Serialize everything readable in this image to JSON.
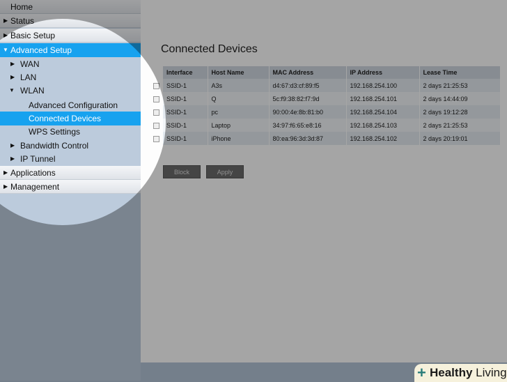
{
  "sidebar": {
    "items": [
      {
        "label": "Home"
      },
      {
        "label": "Status"
      },
      {
        "label": "Basic Setup"
      },
      {
        "label": "Advanced Setup"
      },
      {
        "label": "WAN"
      },
      {
        "label": "LAN"
      },
      {
        "label": "WLAN"
      },
      {
        "label": "Advanced Configuration"
      },
      {
        "label": "Connected Devices"
      },
      {
        "label": "WPS Settings"
      },
      {
        "label": "Bandwidth Control"
      },
      {
        "label": "IP Tunnel"
      },
      {
        "label": "Applications"
      },
      {
        "label": "Management"
      }
    ]
  },
  "main": {
    "title": "Connected Devices",
    "columns": [
      "Interface",
      "Host Name",
      "MAC Address",
      "IP Address",
      "Lease Time"
    ],
    "rows": [
      [
        "SSID-1",
        "A3s",
        "d4:67:d3:cf:89:f5",
        "192.168.254.100",
        "2 days 21:25:53"
      ],
      [
        "SSID-1",
        "Q",
        "5c:f9:38:82:f7:9d",
        "192.168.254.101",
        "2 days 14:44:09"
      ],
      [
        "SSID-1",
        "pc",
        "90:00:4e:8b:81:b0",
        "192.168.254.104",
        "2 days 19:12:28"
      ],
      [
        "SSID-1",
        "Laptop",
        "34:97:f6:65:e8:16",
        "192.168.254.103",
        "2 days 21:25:53"
      ],
      [
        "SSID-1",
        "iPhone",
        "80:ea:96:3d:3d:87",
        "192.168.254.102",
        "2 days 20:19:01"
      ]
    ],
    "block_label": "Block",
    "apply_label": "Apply"
  },
  "watermark": {
    "bold": "Healthy",
    "rest": " Living"
  }
}
